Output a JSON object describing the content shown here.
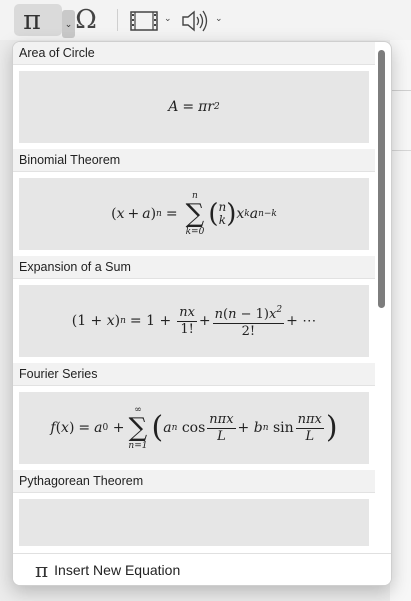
{
  "toolbar": {
    "equation_icon": "pi-icon",
    "equation_caret": "chevron-down-icon",
    "symbol_icon": "omega-icon",
    "media_icon": "film-icon",
    "audio_icon": "speaker-icon",
    "pi_glyph": "π",
    "omega_glyph": "Ω",
    "caret_glyph": "⌄"
  },
  "equations": [
    {
      "title": "Area of Circle"
    },
    {
      "title": "Binomial Theorem"
    },
    {
      "title": "Expansion of a Sum"
    },
    {
      "title": "Fourier Series"
    },
    {
      "title": "Pythagorean Theorem"
    }
  ],
  "footer": {
    "icon": "pi-icon",
    "pi_glyph": "π",
    "label": "Insert New Equation"
  },
  "colors": {
    "popup_bg": "#ffffff",
    "header_bg": "#f2f2f2",
    "card_bg": "#e6e6e6",
    "scroll_thumb": "#7d7d7d"
  }
}
